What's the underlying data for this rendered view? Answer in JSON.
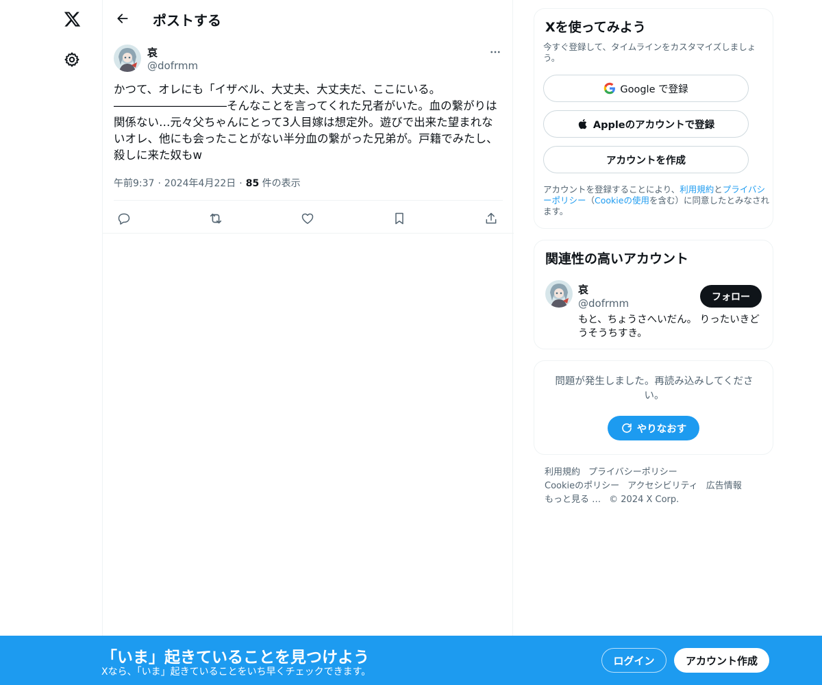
{
  "colors": {
    "accent": "#1d9bf0",
    "text": "#0f1419",
    "muted": "#536471",
    "border": "#eff3f4"
  },
  "nav": {
    "logo_icon": "x-logo-icon",
    "settings_icon": "gear-icon"
  },
  "header": {
    "title": "ポストする",
    "back_icon": "arrow-left-icon"
  },
  "post": {
    "author_name": "哀",
    "author_handle": "@dofrmm",
    "text": "かつて、オレにも「イザベル、大丈夫、大丈夫だ、ここにいる。\n――――――――――そんなことを言ってくれた兄者がいた。血の繋がりは関係ない…元々父ちゃんにとって3人目嫁は想定外。遊びで出来た望まれないオレ、他にも会ったことがない半分血の繋がった兄弟が。戸籍でみたし、殺しに来た奴もw",
    "time": "午前9:37",
    "date": "2024年4月22日",
    "views_count": "85",
    "views_label": "件の表示",
    "meta_sep": "·",
    "actions": [
      "reply-icon",
      "repost-icon",
      "like-icon",
      "bookmark-icon",
      "share-icon"
    ]
  },
  "signup": {
    "title": "Xを使ってみよう",
    "subtitle": "今すぐ登録して、タイムラインをカスタマイズしましょう。",
    "google_label": "Google で登録",
    "apple_label": "Appleのアカウントで登録",
    "create_label": "アカウントを作成",
    "terms_1": "アカウントを登録することにより、",
    "terms_link_1": "利用規約",
    "terms_2": "と",
    "terms_link_2": "プライバシーポリシー",
    "terms_3": "（",
    "terms_link_3": "Cookieの使用",
    "terms_4": "を含む）に同意したとみなされます。"
  },
  "related": {
    "title": "関連性の高いアカウント",
    "name": "哀",
    "handle": "@dofrmm",
    "follow_label": "フォロー",
    "bio": "もと、ちょうさへいだん。 りったいきどうそうちすき。"
  },
  "error": {
    "message": "問題が発生しました。再読み込みしてください。",
    "retry_label": "やりなおす"
  },
  "footer": {
    "links": [
      "利用規約",
      "プライバシーポリシー",
      "Cookieのポリシー",
      "アクセシビリティ",
      "広告情報",
      "もっと見る …"
    ],
    "copyright": "© 2024 X Corp."
  },
  "banner": {
    "title": "「いま」起きていることを見つけよう",
    "subtitle": "Xなら、「いま」起きていることをいち早くチェックできます。",
    "login_label": "ログイン",
    "signup_label": "アカウント作成"
  }
}
